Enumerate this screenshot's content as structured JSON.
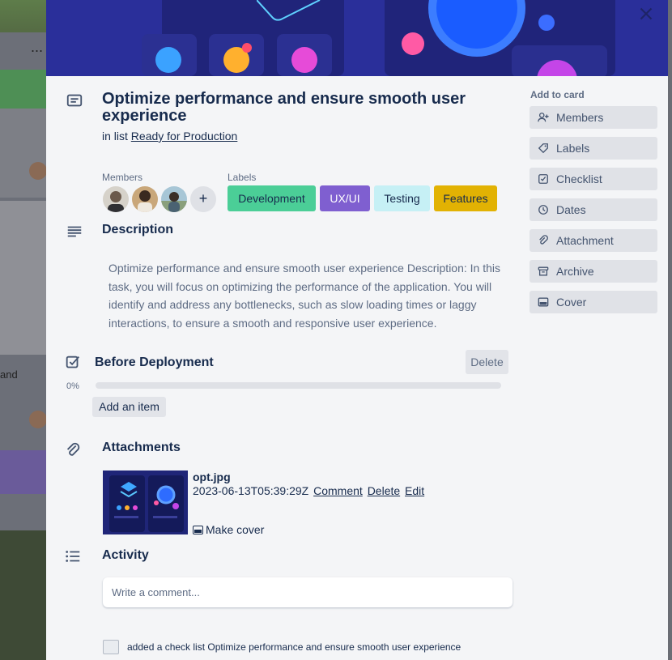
{
  "card": {
    "title": "Optimize performance and ensure smooth user experience",
    "in_list_prefix": "in list",
    "list_name": "Ready for Production"
  },
  "members": {
    "heading": "Members",
    "add_symbol": "+",
    "avatars": [
      "avatar-1",
      "avatar-2",
      "avatar-3"
    ]
  },
  "labels": {
    "heading": "Labels",
    "items": [
      {
        "name": "Development",
        "color": "#4bce97"
      },
      {
        "name": "UX/UI",
        "color": "#7f5fd0"
      },
      {
        "name": "Testing",
        "color": "#c6f0f5"
      },
      {
        "name": "Features",
        "color": "#e2b203"
      }
    ]
  },
  "description": {
    "heading": "Description",
    "text": "Optimize performance and ensure smooth user experience Description: In this task, you will focus on optimizing the performance of the application. You will identify and address any bottlenecks, such as slow loading times or laggy interactions, to ensure a smooth and responsive user experience."
  },
  "checklist": {
    "title": "Before Deployment",
    "delete_label": "Delete",
    "progress_text": "0%",
    "progress": 0,
    "add_item_label": "Add an item"
  },
  "attachments": {
    "heading": "Attachments",
    "file_name": "opt.jpg",
    "timestamp": "2023-06-13T05:39:29Z",
    "comment_label": "Comment",
    "delete_label": "Delete",
    "edit_label": "Edit",
    "make_cover_label": "Make cover"
  },
  "activity": {
    "heading": "Activity",
    "comment_placeholder": "Write a comment...",
    "entry_text": "added a check list Optimize performance and ensure smooth user experience"
  },
  "sidebar": {
    "heading": "Add to card",
    "items": [
      {
        "label": "Members",
        "icon": "member-icon"
      },
      {
        "label": "Labels",
        "icon": "tag-icon"
      },
      {
        "label": "Checklist",
        "icon": "checklist-icon"
      },
      {
        "label": "Dates",
        "icon": "clock-icon"
      },
      {
        "label": "Attachment",
        "icon": "paperclip-icon"
      },
      {
        "label": "Archive",
        "icon": "archive-icon"
      },
      {
        "label": "Cover",
        "icon": "cover-icon"
      }
    ]
  },
  "background": {
    "dots": "...",
    "partial_text": "and"
  }
}
